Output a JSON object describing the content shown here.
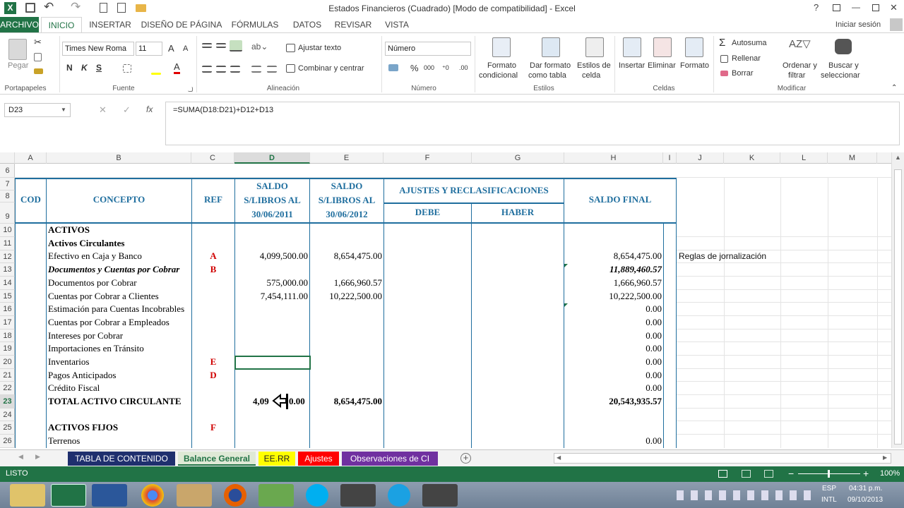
{
  "window": {
    "title": "Estados Financieros (Cuadrado)  [Modo de compatibilidad] - Excel",
    "help": "?",
    "minimize": "—",
    "close": "✕"
  },
  "qat": {
    "undo": "↶",
    "redo": "↷"
  },
  "tabs": {
    "file": "ARCHIVO",
    "items": [
      "INICIO",
      "INSERTAR",
      "DISEÑO DE PÁGINA",
      "FÓRMULAS",
      "DATOS",
      "REVISAR",
      "VISTA"
    ],
    "signin": "Iniciar sesión"
  },
  "ribbon": {
    "clipboard": {
      "paste": "Pegar",
      "label": "Portapapeles"
    },
    "font": {
      "name": "Times New Roma",
      "size": "11",
      "bold": "N",
      "italic": "K",
      "underline": "S",
      "label": "Fuente",
      "grow": "A",
      "shrink": "A",
      "color_letter": "A"
    },
    "alignment": {
      "wrap": "Ajustar texto",
      "merge": "Combinar y centrar",
      "label": "Alineación"
    },
    "number": {
      "format": "Número",
      "percent": "%",
      "thousands": "000",
      "label": "Número"
    },
    "styles": {
      "cond1": "Formato",
      "cond2": "condicional",
      "table1": "Dar formato",
      "table2": "como tabla",
      "cellst1": "Estilos de",
      "cellst2": "celda",
      "label": "Estilos"
    },
    "cells": {
      "insert": "Insertar",
      "delete": "Eliminar",
      "format": "Formato",
      "label": "Celdas"
    },
    "editing": {
      "autosum": "Autosuma",
      "fill": "Rellenar",
      "clear": "Borrar",
      "sort1": "Ordenar y",
      "sort2": "filtrar",
      "find1": "Buscar y",
      "find2": "seleccionar",
      "label": "Modificar"
    }
  },
  "formula_bar": {
    "name_box": "D23",
    "fx": "fx",
    "formula": "=SUMA(D18:D21)+D12+D13"
  },
  "columns": [
    "A",
    "B",
    "C",
    "D",
    "E",
    "F",
    "G",
    "H",
    "I",
    "J",
    "K",
    "L",
    "M"
  ],
  "rows": [
    "6",
    "7",
    "8",
    "9",
    "10",
    "11",
    "12",
    "13",
    "14",
    "15",
    "16",
    "17",
    "18",
    "19",
    "20",
    "21",
    "22",
    "23",
    "24",
    "25",
    "26"
  ],
  "sheet": {
    "header": {
      "cod": "COD",
      "concepto": "CONCEPTO",
      "ref": "REF",
      "saldo_2011_l1": "SALDO",
      "saldo_2011_l2": "S/LIBROS AL",
      "saldo_2011_l3": "30/06/2011",
      "saldo_2012_l1": "SALDO",
      "saldo_2012_l2": "S/LIBROS AL",
      "saldo_2012_l3": "30/06/2012",
      "ajustes": "AJUSTES Y RECLASIFICACIONES",
      "debe": "DEBE",
      "haber": "HABER",
      "saldo_final": "SALDO FINAL"
    },
    "r10": "ACTIVOS",
    "r11": "Activos Circulantes",
    "r12": {
      "b": "Efectivo en Caja y Banco",
      "c": "A",
      "d": "4,099,500.00",
      "e": "8,654,475.00",
      "h": "8,654,475.00",
      "j": "Reglas de jornalización"
    },
    "r13": {
      "b": "Documentos y Cuentas por Cobrar",
      "c": "B",
      "h": "11,889,460.57"
    },
    "r14": {
      "b": "Documentos por Cobrar",
      "d": "575,000.00",
      "e": "1,666,960.57",
      "h": "1,666,960.57"
    },
    "r15": {
      "b": "Cuentas por Cobrar a Clientes",
      "d": "7,454,111.00",
      "e": "10,222,500.00",
      "h": "10,222,500.00"
    },
    "r16": {
      "b": "Estimación para Cuentas Incobrables",
      "h": "0.00"
    },
    "r17": {
      "b": "Cuentas por Cobrar a Empleados",
      "h": "0.00"
    },
    "r18": {
      "b": "Intereses por Cobrar",
      "h": "0.00"
    },
    "r19": {
      "b": "Importaciones en Tránsito",
      "h": "0.00"
    },
    "r20": {
      "b": "Inventarios",
      "c": "E",
      "h": "0.00"
    },
    "r21": {
      "b": "Pagos Anticipados",
      "c": "D",
      "h": "0.00"
    },
    "r22": {
      "b": "Crédito Fiscal",
      "h": "0.00"
    },
    "r23": {
      "b": "TOTAL ACTIVO CIRCULANTE",
      "d": "4,09",
      "d2": "0.00",
      "e": "8,654,475.00",
      "h": "20,543,935.57"
    },
    "r25": {
      "b": "ACTIVOS FIJOS",
      "c": "F"
    },
    "r26": {
      "b": "Terrenos",
      "h": "0.00"
    }
  },
  "sheet_tabs": [
    {
      "label": "TABLA DE CONTENIDO",
      "color": "#1f2f6e"
    },
    {
      "label": "Balance General",
      "color": "#dfe9d6"
    },
    {
      "label": "EE.RR",
      "color": "#ffff00"
    },
    {
      "label": "Ajustes",
      "color": "#ff0000"
    },
    {
      "label": "Observaciones de CI",
      "color": "#7030a0"
    }
  ],
  "status": {
    "ready": "LISTO",
    "zoom": "100%",
    "minus": "−",
    "plus": "+"
  },
  "taskbar": {
    "lang1": "ESP",
    "lang2": "INTL",
    "time": "04:31 p.m.",
    "date": "09/10/2013"
  }
}
